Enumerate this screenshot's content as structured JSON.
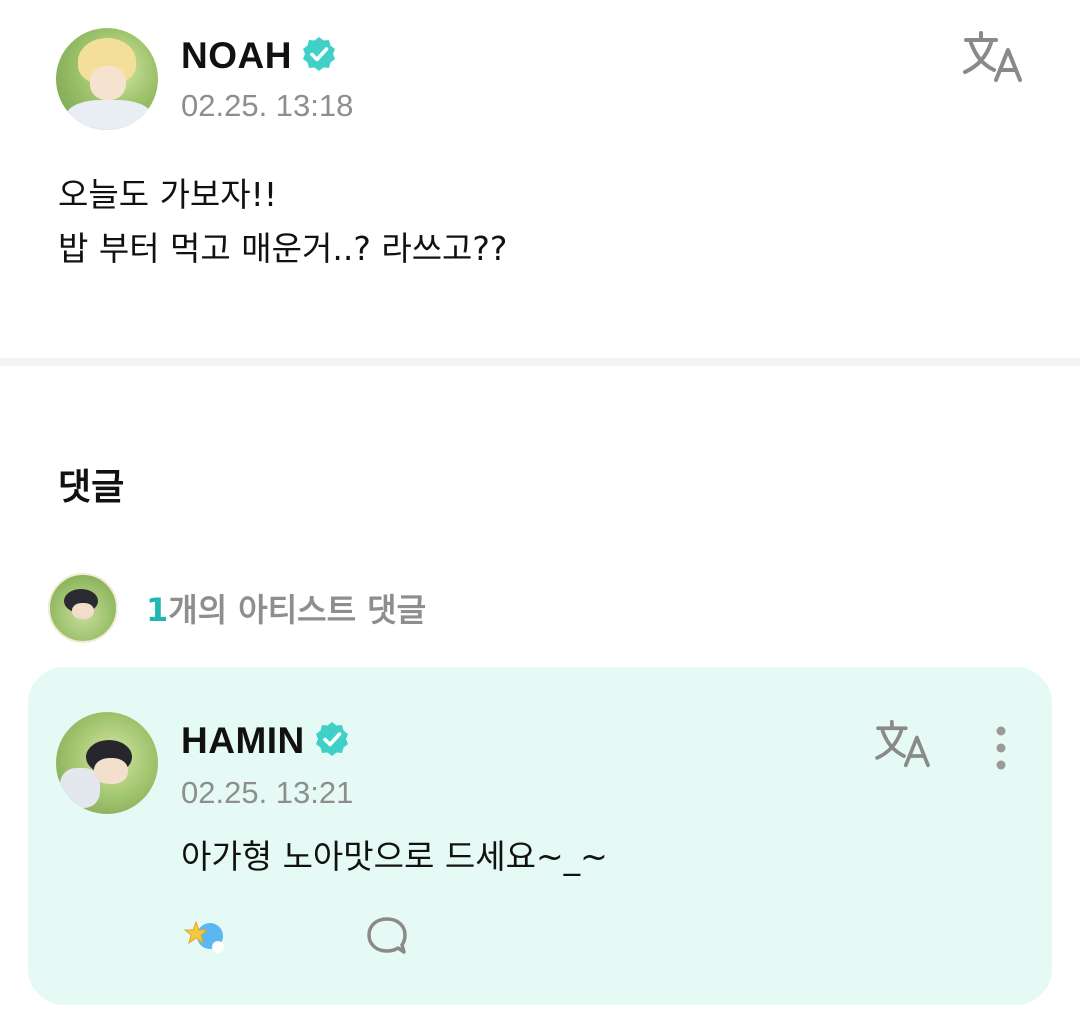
{
  "post": {
    "author_name": "NOAH",
    "timestamp": "02.25. 13:18",
    "body_lines": [
      "오늘도 가보자!!",
      "밥 부터 먹고 매운거..? 라쓰고??"
    ],
    "translate_icon": "translate-icon",
    "verified_icon": "verified-badge-icon"
  },
  "comments": {
    "heading": "댓글",
    "artist_summary": {
      "count": "1",
      "text": "개의 아티스트 댓글"
    },
    "items": [
      {
        "author_name": "HAMIN",
        "timestamp": "02.25. 13:21",
        "body": "아가형 노아맛으로 드세요~_~",
        "icons": [
          "translate-icon",
          "more-vertical-icon",
          "reaction-icon",
          "reply-bubble-icon"
        ]
      }
    ]
  },
  "colors": {
    "accent_teal": "#1fb8b1",
    "verified_badge": "#3fd1c7",
    "comment_card_bg": "#e6faf5",
    "muted_text": "#8e8e8e"
  }
}
